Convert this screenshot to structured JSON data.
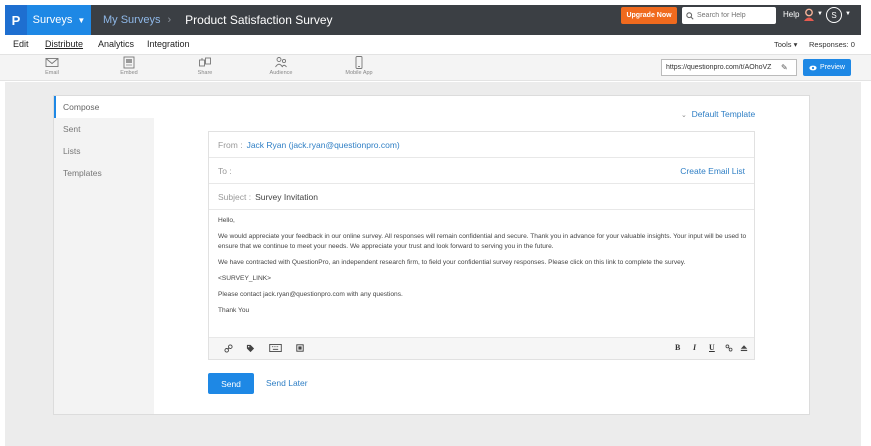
{
  "topbar": {
    "logo": "P",
    "surveys_label": "Surveys",
    "breadcrumb_parent": "My Surveys",
    "breadcrumb_sep": "›",
    "survey_title": "Product Satisfaction Survey",
    "upgrade_label": "Upgrade Now",
    "search_placeholder": "Search for Help",
    "help_label": "Help",
    "avatar_initial": "S"
  },
  "menu": {
    "items": [
      "Edit",
      "Distribute",
      "Analytics",
      "Integration"
    ],
    "active": "Distribute",
    "tools_label": "Tools ▾",
    "responses_label": "Responses: 0"
  },
  "toolbar": {
    "tools": [
      {
        "label": "Email",
        "icon": "envelope-icon"
      },
      {
        "label": "Embed",
        "icon": "embed-icon"
      },
      {
        "label": "Share",
        "icon": "share-icon"
      },
      {
        "label": "Audience",
        "icon": "audience-icon"
      },
      {
        "label": "Mobile App",
        "icon": "mobile-icon"
      }
    ],
    "survey_url": "https://questionpro.com/t/AOhoVZ",
    "preview_label": "Preview"
  },
  "leftnav": {
    "items": [
      "Compose",
      "Sent",
      "Lists",
      "Templates"
    ],
    "active": "Compose"
  },
  "compose": {
    "template_label": "Default Template",
    "from_label": "From :",
    "from_value": "Jack Ryan (jack.ryan@questionpro.com)",
    "to_label": "To :",
    "create_list_label": "Create Email List",
    "subject_label": "Subject :",
    "subject_value": "Survey Invitation",
    "body": {
      "greeting": "Hello,",
      "p1": "We would appreciate your feedback in our online survey.  All responses will remain confidential and secure.  Thank you in advance for your valuable insights.  Your input will be used to ensure that we continue to meet your needs. We appreciate your trust and look forward to serving you in the future.",
      "p2": "We have contracted with QuestionPro, an independent research firm, to field your confidential survey responses.  Please click on this link to complete the survey.",
      "link": "<SURVEY_LINK>",
      "contact": "Please contact jack.ryan@questionpro.com with any questions.",
      "signoff": "Thank You"
    },
    "format_buttons": [
      "B",
      "I",
      "U"
    ],
    "send_label": "Send",
    "send_later_label": "Send Later"
  },
  "colors": {
    "accent": "#1e88e5",
    "topbar": "#3b3f44",
    "upgrade": "#f06a1e",
    "link": "#2f7fc5"
  }
}
